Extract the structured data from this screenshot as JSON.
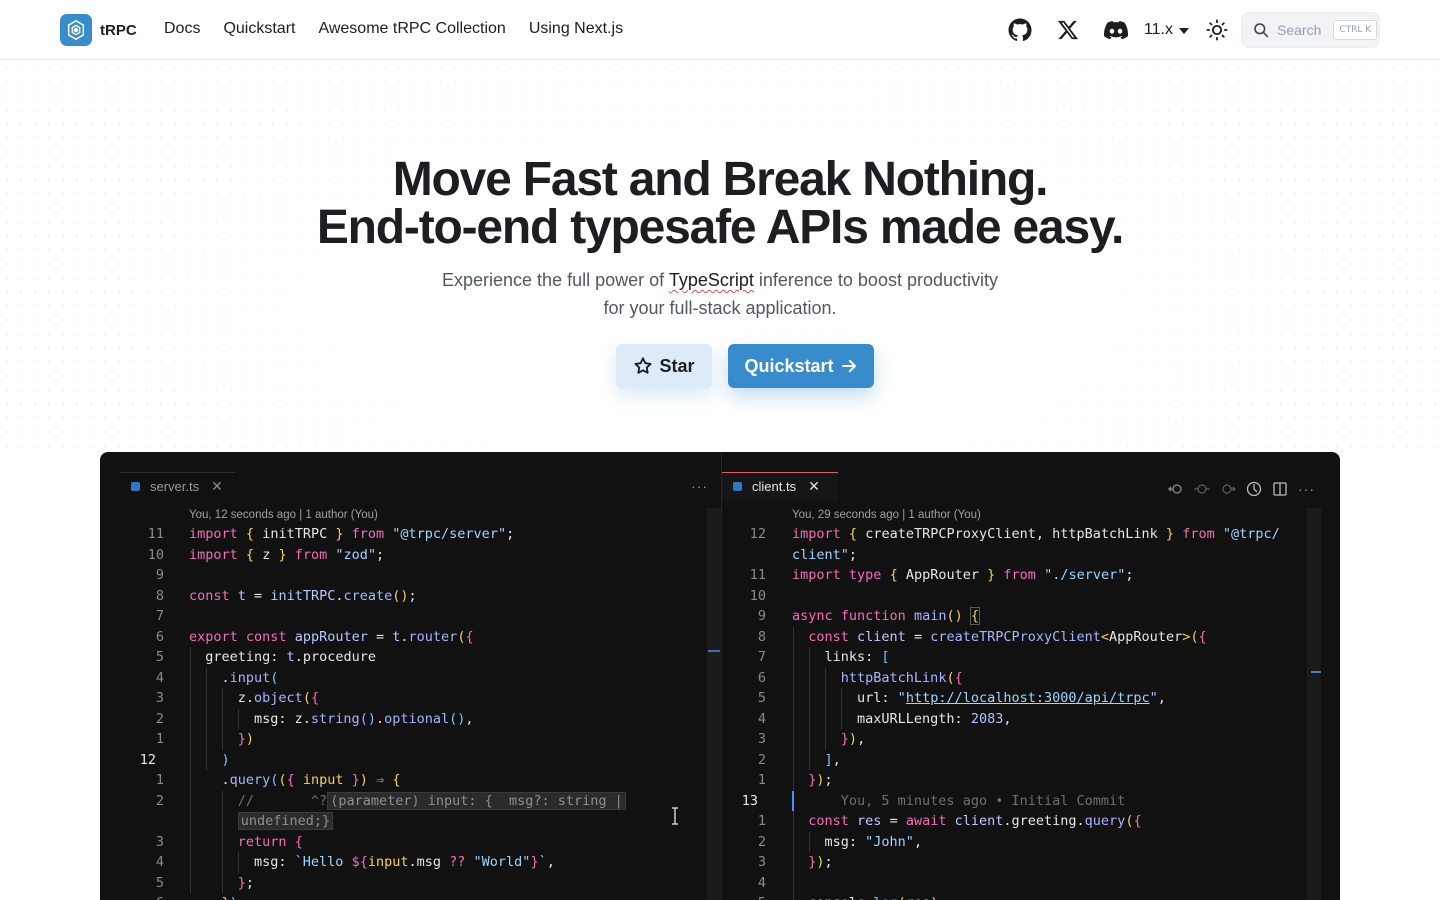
{
  "nav": {
    "brand": "tRPC",
    "links": [
      "Docs",
      "Quickstart",
      "Awesome tRPC Collection",
      "Using Next.js"
    ],
    "icons": [
      "github-icon",
      "x-icon",
      "discord-icon"
    ],
    "version": "11.x",
    "search_placeholder": "Search",
    "search_shortcut": "CTRL K"
  },
  "hero": {
    "title_line1": "Move Fast and Break Nothing.",
    "title_line2": "End-to-end typesafe APIs made easy.",
    "sub_before": "Experience the full power of ",
    "sub_highlight": "TypeScript",
    "sub_after": " inference to boost productivity",
    "sub_line2": "for your full-stack application.",
    "star_label": "Star",
    "quickstart_label": "Quickstart"
  },
  "editor": {
    "left": {
      "tab": "server.ts",
      "blame": "You, 12 seconds ago | 1 author (You)",
      "menu": "···"
    },
    "right": {
      "tab": "client.ts",
      "blame": "You, 29 seconds ago | 1 author (You)",
      "menu": "···"
    }
  },
  "colors": {
    "brand": "#398ccb",
    "editor_bg": "#111111",
    "keyword": "#f46cb7",
    "string": "#9fd4ff"
  }
}
